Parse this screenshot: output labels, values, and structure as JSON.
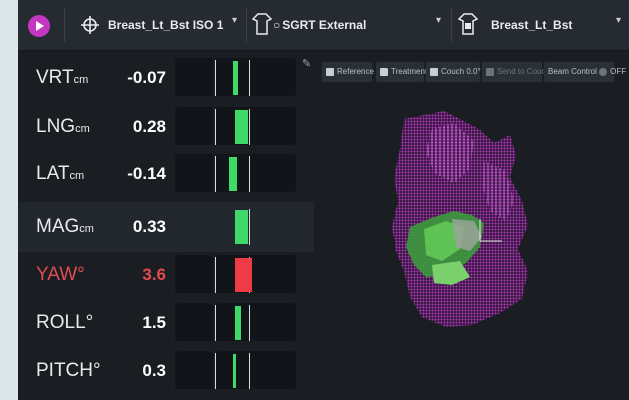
{
  "topbar": {
    "isocenter": "Breast_Lt_Bst ISO 1",
    "surface": "SGRT External",
    "reference": "Breast_Lt_Bst"
  },
  "toolbar": {
    "reference": "Reference",
    "treatment": "Treatment",
    "couch": "Couch 0.0°",
    "send_to_couch": "Send to Couch",
    "beam_control": "Beam Control",
    "beam_state": "OFF"
  },
  "rows": [
    {
      "label": "VRT",
      "unit": "cm",
      "value": "-0.07",
      "alert": false
    },
    {
      "label": "LNG",
      "unit": "cm",
      "value": "0.28",
      "alert": false
    },
    {
      "label": "LAT",
      "unit": "cm",
      "value": "-0.14",
      "alert": false
    },
    {
      "label": "MAG",
      "unit": "cm",
      "value": "0.33",
      "alert": false
    },
    {
      "label": "YAW",
      "unit": "°",
      "value": "3.6",
      "alert": true
    },
    {
      "label": "ROLL",
      "unit": "°",
      "value": "1.5",
      "alert": false
    },
    {
      "label": "PITCH",
      "unit": "°",
      "value": "0.3",
      "alert": false
    }
  ],
  "colors": {
    "ok": "#3fd96a",
    "alert": "#ef3b45",
    "accent": "#c536c0",
    "surface_points": "#b23ac0"
  },
  "icons": {
    "play": "play-icon",
    "isocenter": "crosshair-icon",
    "surface": "torso-outline-icon",
    "reference": "torso-icon",
    "edit": "pencil-icon"
  }
}
